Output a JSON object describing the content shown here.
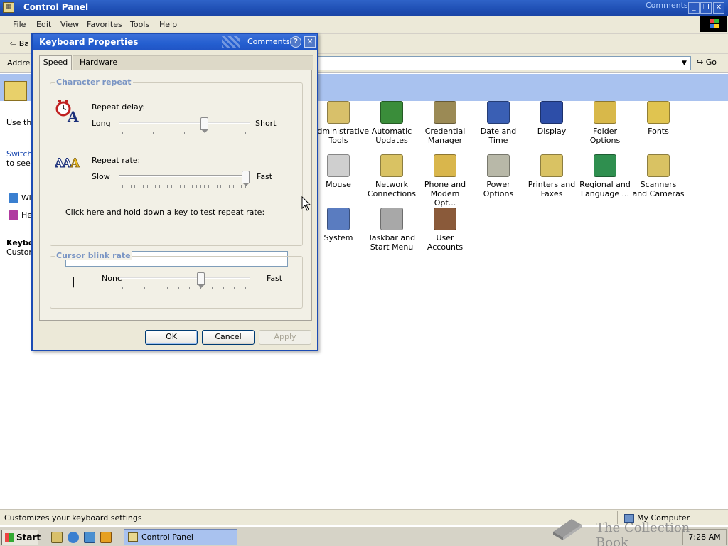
{
  "explorer": {
    "title": "Control Panel",
    "comments_link": "Comments?",
    "menu": [
      "File",
      "Edit",
      "View",
      "Favorites",
      "Tools",
      "Help"
    ],
    "back_label": "Ba",
    "address_label": "Addres",
    "go_label": "Go",
    "left_pane": {
      "description": "Use the personalize",
      "switch_link": "Switch",
      "switch_text": "to see it categor",
      "link_windows_update": "Wi",
      "link_help": "He",
      "selected_title": "Keybo",
      "selected_desc": "Custom"
    },
    "items": [
      {
        "label": "Administrative Tools",
        "icon": "administrative-tools-icon",
        "color": "#d8c06a"
      },
      {
        "label": "Automatic Updates",
        "icon": "automatic-updates-icon",
        "color": "#3a8d3a"
      },
      {
        "label": "Credential Manager",
        "icon": "credential-manager-icon",
        "color": "#9b8a55"
      },
      {
        "label": "Date and Time",
        "icon": "date-and-time-icon",
        "color": "#3a5fb4"
      },
      {
        "label": "Display",
        "icon": "display-icon",
        "color": "#2d4ea8"
      },
      {
        "label": "Folder Options",
        "icon": "folder-options-icon",
        "color": "#d8b84a"
      },
      {
        "label": "Fonts",
        "icon": "fonts-icon",
        "color": "#e0c450"
      },
      {
        "label": "Mouse",
        "icon": "mouse-icon",
        "color": "#cfcfcf"
      },
      {
        "label": "Network Connections",
        "icon": "network-connections-icon",
        "color": "#d9c263"
      },
      {
        "label": "Phone and Modem Opt...",
        "icon": "phone-modem-icon",
        "color": "#d9b64c"
      },
      {
        "label": "Power Options",
        "icon": "power-options-icon",
        "color": "#b8b8a8"
      },
      {
        "label": "Printers and Faxes",
        "icon": "printers-faxes-icon",
        "color": "#d9c263"
      },
      {
        "label": "Regional and Language ...",
        "icon": "regional-language-icon",
        "color": "#2f8f4f"
      },
      {
        "label": "Scanners and Cameras",
        "icon": "scanners-cameras-icon",
        "color": "#d9c263"
      },
      {
        "label": "System",
        "icon": "system-icon",
        "color": "#5a7cc0"
      },
      {
        "label": "Taskbar and Start Menu",
        "icon": "taskbar-start-icon",
        "color": "#a8a8a8"
      },
      {
        "label": "User Accounts",
        "icon": "user-accounts-icon",
        "color": "#8a5a3a"
      }
    ],
    "status_message": "Customizes your keyboard settings",
    "status_zone": "My Computer"
  },
  "dialog": {
    "title": "Keyboard Properties",
    "comments_link": "Comments?",
    "help_glyph": "?",
    "close_glyph": "✕",
    "tabs": [
      "Speed",
      "Hardware"
    ],
    "character_repeat": {
      "legend": "Character repeat",
      "repeat_delay_label": "Repeat delay:",
      "delay_min": "Long",
      "delay_max": "Short",
      "delay_value": 0.667,
      "repeat_rate_label": "Repeat rate:",
      "rate_min": "Slow",
      "rate_max": "Fast",
      "rate_value": 1.0,
      "test_label": "Click here and hold down a key to test repeat rate:",
      "test_value": ""
    },
    "cursor_blink": {
      "legend": "Cursor blink rate",
      "cursor_glyph": "|",
      "min": "None",
      "max": "Fast",
      "value": 0.636
    },
    "buttons": {
      "ok": "OK",
      "cancel": "Cancel",
      "apply": "Apply"
    }
  },
  "taskbar": {
    "start": "Start",
    "task": "Control Panel",
    "clock": "7:28 AM"
  },
  "watermark": "The Collection Book"
}
